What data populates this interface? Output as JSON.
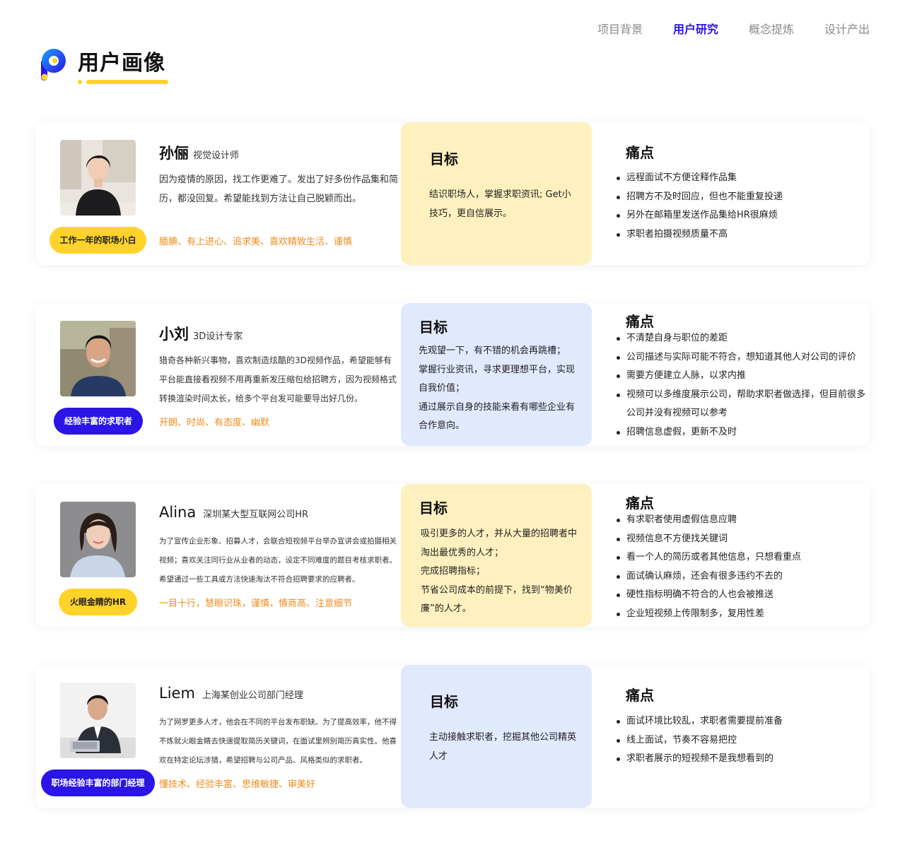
{
  "nav": [
    "项目背景",
    "用户研究",
    "概念提炼",
    "设计产出"
  ],
  "page_title": "用户画像",
  "colors": {
    "brand": "#2a14e6",
    "accent_yellow": "#ffd329",
    "trait_orange": "#f28a1a",
    "goal_yellow": "#fff1bf",
    "goal_blue": "#e1e9ff"
  },
  "personas": [
    {
      "name": "孙俪",
      "role": "视觉设计师",
      "badge": "工作一年的职场小白",
      "description": "因为疫情的原因，找工作更难了。发出了好多份作品集和简历，都没回复。希望能找到方法让自己脱颖而出。",
      "traits": "腼腆、有上进心、追求美、喜欢精致生活、谨慎",
      "goal_title": "目标",
      "goals": [
        "结识职场人，掌握求职资讯; Get小技巧，更自信展示。"
      ],
      "pain_title": "痛点",
      "pains": [
        "远程面试不方便诠释作品集",
        "招聘方不及时回应，但也不能重复投递",
        " 另外在邮箱里发送作品集给HR很麻烦",
        "求职者拍摄视频质量不高"
      ]
    },
    {
      "name": "小刘",
      "role": "3D设计专家",
      "badge": "经验丰富的求职者",
      "description": "猎奇各种新兴事物，喜欢制造炫酷的3D视频作品，希望能够有平台能直接看视频不用再重新发压缩包给招聘方，因为视频格式转换渲染时间太长，给多个平台发可能要导出好几份。",
      "traits": "开朗、时尚、有态度、幽默",
      "goal_title": "目标",
      "goals": [
        "先观望一下，有不错的机会再跳槽；",
        "掌握行业资讯，寻求更理想平台，实现自我价值；",
        "通过展示自身的技能来看有哪些企业有合作意向。"
      ],
      "pain_title": "痛点",
      "pains": [
        "不清楚自身与职位的差距",
        "公司描述与实际可能不符合，想知道其他人对公司的评价",
        "需要方便建立人脉，以求内推",
        "视频可以多维度展示公司，帮助求职者做选择，但目前很多公司并没有视频可以参考",
        "招聘信息虚假，更新不及时"
      ]
    },
    {
      "name": "Alina",
      "role": "深圳某大型互联网公司HR",
      "badge": "火眼金睛的HR",
      "description": "为了宣传企业形象、招募人才，会联合短视频平台举办宣讲会或拍摄相关视频；喜欢关注同行业从业者的动态，设定不同难度的题目考核求职者。希望通过一些工具或方法快速淘汰不符合招聘要求的应聘者。",
      "traits": "一目十行，慧眼识珠，谨慎，情商高、注意细节",
      "goal_title": "目标",
      "goals": [
        "吸引更多的人才，并从大量的招聘者中淘出最优秀的人才；",
        "完成招聘指标；",
        "节省公司成本的前提下，找到“物美价廉”的人才。"
      ],
      "pain_title": "痛点",
      "pains": [
        "有求职者使用虚假信息应聘",
        "视频信息不方便找关键词",
        "看一个人的简历或者其他信息，只想看重点",
        "面试确认麻烦，还会有很多违约不去的",
        "硬性指标明确不符合的人也会被推送",
        "企业短视频上传限制多，复用性差"
      ]
    },
    {
      "name": "Liem",
      "role": "上海某创业公司部门经理",
      "badge": "职场经验丰富的部门经理",
      "description": "为了网罗更多人才，他会在不同的平台发布职缺。为了提高效率，他不得不炼就火眼金睛去快速提取简历关键词，在面试里辨别简历真实性。他喜欢在特定论坛涉猎，希望招聘与公司产品、风格类似的求职者。",
      "traits": "懂技术、经验丰富、思维敏捷、审美好",
      "goal_title": "目标",
      "goals": [
        "主动接触求职者，挖掘其他公司精英人才"
      ],
      "pain_title": "痛点",
      "pains": [
        "面试环境比较乱，求职者需要提前准备",
        "线上面试，节奏不容易把控",
        "求职者展示的短视频不是我想看到的"
      ]
    }
  ]
}
